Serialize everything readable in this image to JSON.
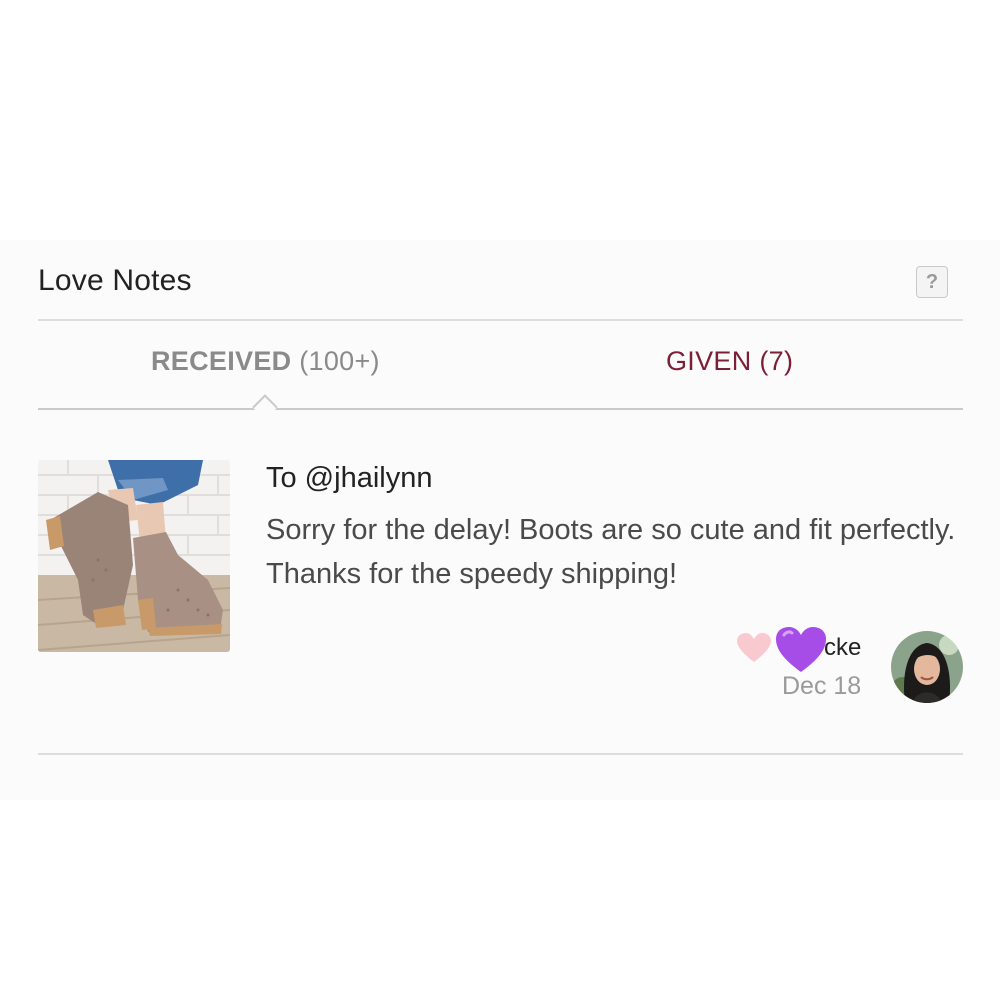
{
  "section": {
    "title": "Love Notes",
    "help_label": "?"
  },
  "tabs": [
    {
      "label": "RECEIVED",
      "count": "(100+)",
      "active": true
    },
    {
      "label": "GIVEN",
      "count": "(7)",
      "active": false
    }
  ],
  "note": {
    "to": "To @jhailynn",
    "body": "Sorry for the delay! Boots are so cute and fit perfectly. Thanks for the speedy shipping!",
    "author": "cke",
    "date": "Dec 18",
    "hearts": [
      "pink-heart-icon",
      "purple-heart-icon"
    ]
  },
  "colors": {
    "accent": "#7b1f36",
    "inactive_tab": "#8a8a8a",
    "pink_heart": "#f9c9d0",
    "purple_heart": "#a64de8"
  }
}
